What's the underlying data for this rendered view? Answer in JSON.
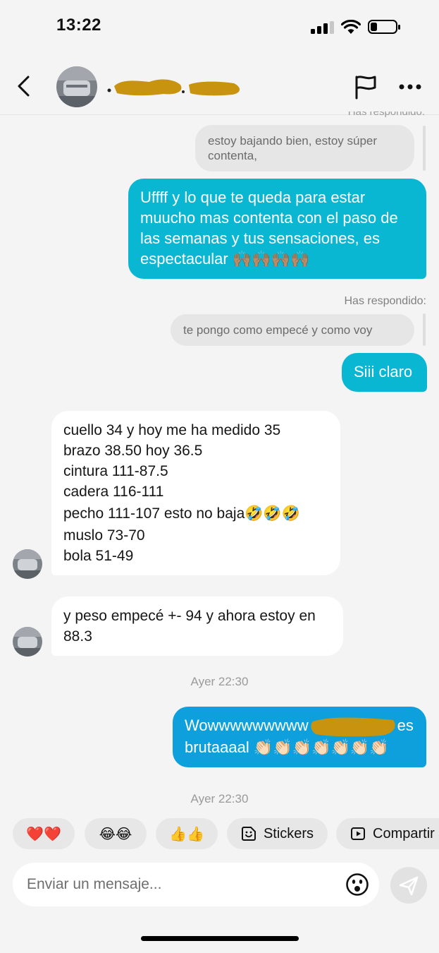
{
  "status_bar": {
    "time": "13:22"
  },
  "header": {
    "icons": [
      "back-icon",
      "flag-icon",
      "more-icon"
    ]
  },
  "conversation": {
    "top_faded_label": "Has respondido:",
    "quote_1": "estoy bajando bien, estoy súper contenta,",
    "reply_1": "Uffff y lo que te queda para estar muucho mas contenta con el paso de las semanas y tus sensaciones, es espectacular",
    "reply_1_emoji": "🙌🏽🙌🏽🙌🏽🙌🏽",
    "has_respondido": "Has respondido:",
    "quote_2": "te pongo como empecé y como voy",
    "reply_2": "Siii claro",
    "incoming_1_lines": [
      "cuello 34 y hoy me ha medido 35",
      "brazo 38.50 hoy 36.5",
      "cintura 111-87.5",
      "cadera 116-111",
      "pecho 111-107 esto no baja🤣🤣🤣",
      "muslo 73-70",
      "bola 51-49"
    ],
    "incoming_2": "y peso empecé +- 94 y ahora estoy en  88.3",
    "timestamp_1": "Ayer 22:30",
    "reply_3_start": "Wowwwwwwwww",
    "reply_3_end": "es brutaaaal",
    "reply_3_emoji": "👏🏻👏🏻👏🏻👏🏻👏🏻👏🏻👏🏻",
    "timestamp_2": "Ayer 22:30"
  },
  "quick_replies": [
    {
      "label": "❤️❤️"
    },
    {
      "label": "😂😂"
    },
    {
      "label": "👍👍"
    },
    {
      "label": "Stickers",
      "icon": "sticker-icon"
    },
    {
      "label": "Compartir",
      "icon": "share-icon"
    }
  ],
  "composer": {
    "placeholder": "Enviar un mensaje..."
  },
  "colors": {
    "outgoing_bubble": "#09b7d3",
    "outgoing_bubble_alt": "#0ea0dc",
    "incoming_bubble": "#ffffff",
    "quote_bubble": "#e6e6e6",
    "background": "#f4f4f4",
    "redaction": "#c8930e"
  }
}
